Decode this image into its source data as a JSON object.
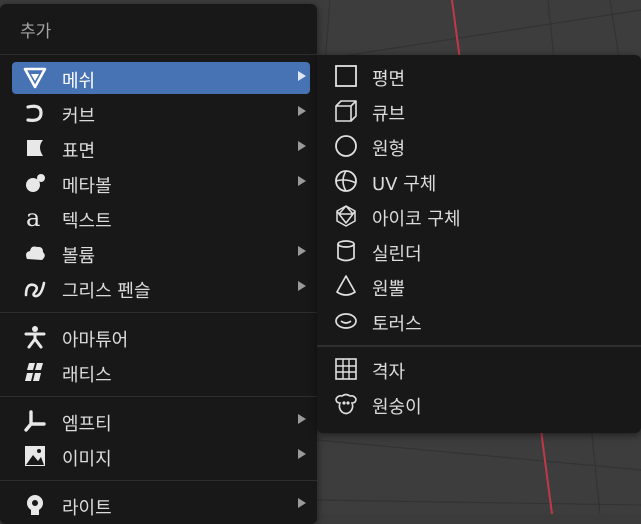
{
  "menu": {
    "title": "추가",
    "items": [
      {
        "label": "메쉬",
        "icon": "mesh-icon",
        "has_submenu": true,
        "active": true
      },
      {
        "label": "커브",
        "icon": "curve-icon",
        "has_submenu": true
      },
      {
        "label": "표면",
        "icon": "surface-icon",
        "has_submenu": true
      },
      {
        "label": "메타볼",
        "icon": "metaball-icon",
        "has_submenu": true
      },
      {
        "label": "텍스트",
        "icon": "text-icon",
        "has_submenu": false
      },
      {
        "label": "볼륨",
        "icon": "volume-icon",
        "has_submenu": true
      },
      {
        "label": "그리스 펜슬",
        "icon": "grease-pencil-icon",
        "has_submenu": true
      },
      {
        "label": "아마튜어",
        "icon": "armature-icon",
        "has_submenu": false
      },
      {
        "label": "래티스",
        "icon": "lattice-icon",
        "has_submenu": false
      },
      {
        "label": "엠프티",
        "icon": "empty-icon",
        "has_submenu": true
      },
      {
        "label": "이미지",
        "icon": "image-icon",
        "has_submenu": true
      },
      {
        "label": "라이트",
        "icon": "light-icon",
        "has_submenu": true
      }
    ]
  },
  "submenu": {
    "items": [
      {
        "label": "평면",
        "icon": "plane-icon"
      },
      {
        "label": "큐브",
        "icon": "cube-icon"
      },
      {
        "label": "원형",
        "icon": "circle-icon"
      },
      {
        "label": "UV 구체",
        "icon": "uv-sphere-icon"
      },
      {
        "label": "아이코 구체",
        "icon": "ico-sphere-icon"
      },
      {
        "label": "실린더",
        "icon": "cylinder-icon"
      },
      {
        "label": "원뿔",
        "icon": "cone-icon"
      },
      {
        "label": "토러스",
        "icon": "torus-icon"
      },
      {
        "label": "격자",
        "icon": "grid-icon"
      },
      {
        "label": "원숭이",
        "icon": "monkey-icon"
      }
    ]
  },
  "colors": {
    "menu_bg": "#181818",
    "highlight": "#4772b3",
    "viewport_bg": "#3d3d3d",
    "axis_x": "#c0394a",
    "axis_y": "#6aa02a"
  }
}
